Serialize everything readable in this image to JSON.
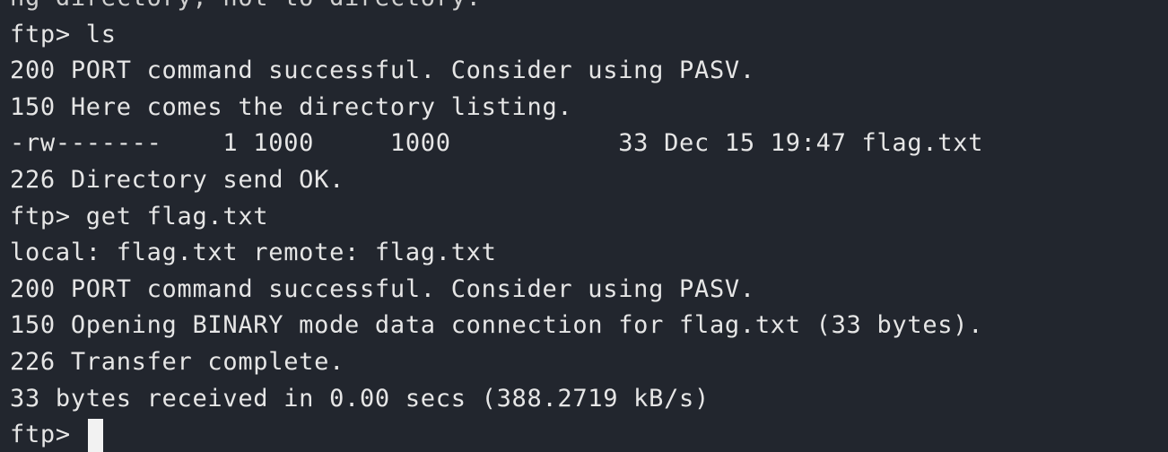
{
  "terminal": {
    "lines": [
      "ng directory, not to directory.",
      "ftp> ls",
      "200 PORT command successful. Consider using PASV.",
      "150 Here comes the directory listing.",
      "-rw-------    1 1000     1000           33 Dec 15 19:47 flag.txt",
      "226 Directory send OK.",
      "ftp> get flag.txt",
      "local: flag.txt remote: flag.txt",
      "200 PORT command successful. Consider using PASV.",
      "150 Opening BINARY mode data connection for flag.txt (33 bytes).",
      "226 Transfer complete.",
      "33 bytes received in 0.00 secs (388.2719 kB/s)"
    ],
    "prompt": "ftp> ",
    "colors": {
      "background": "#22262e",
      "text": "#e6e6e6",
      "cursor": "#f2f2f2"
    }
  }
}
